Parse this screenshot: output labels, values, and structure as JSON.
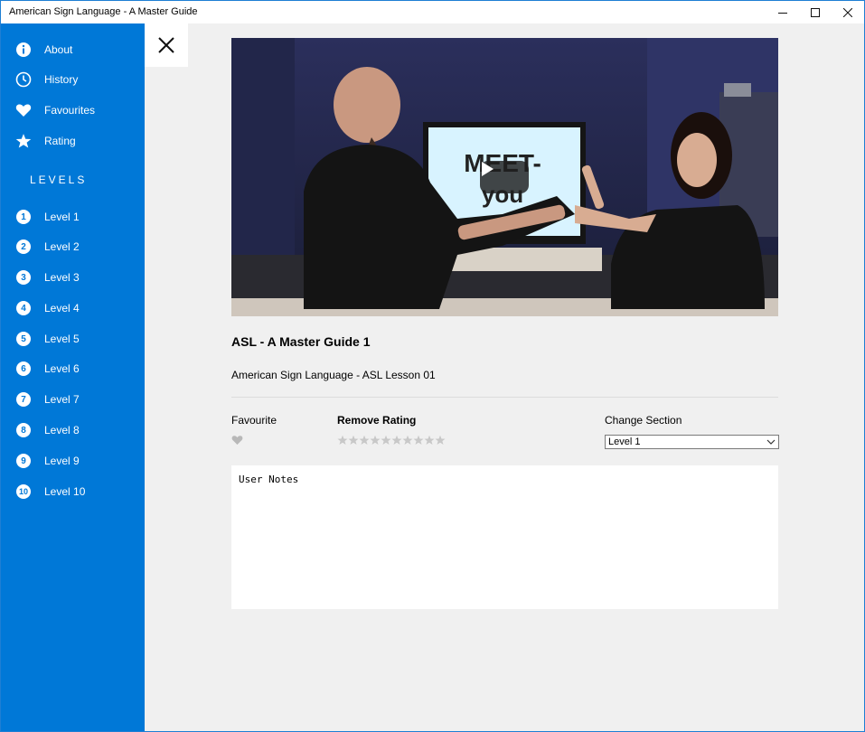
{
  "window": {
    "title": "American Sign Language - A Master Guide"
  },
  "sidebar": {
    "items": [
      {
        "label": "About",
        "icon": "info-icon"
      },
      {
        "label": "History",
        "icon": "clock-icon"
      },
      {
        "label": "Favourites",
        "icon": "heart-icon"
      },
      {
        "label": "Rating",
        "icon": "star-icon"
      }
    ],
    "levels_header": "LEVELS",
    "levels": [
      {
        "num": "1",
        "label": "Level 1"
      },
      {
        "num": "2",
        "label": "Level 2"
      },
      {
        "num": "3",
        "label": "Level 3"
      },
      {
        "num": "4",
        "label": "Level 4"
      },
      {
        "num": "5",
        "label": "Level 5"
      },
      {
        "num": "6",
        "label": "Level 6"
      },
      {
        "num": "7",
        "label": "Level 7"
      },
      {
        "num": "8",
        "label": "Level 8"
      },
      {
        "num": "9",
        "label": "Level 9"
      },
      {
        "num": "10",
        "label": "Level 10"
      }
    ]
  },
  "video": {
    "sign_text_line1": "MEET-",
    "sign_text_line2": "you",
    "title": "ASL - A Master Guide 1",
    "subtitle": "American Sign Language - ASL Lesson 01"
  },
  "controls": {
    "favourite_label": "Favourite",
    "rating_label": "Remove Rating",
    "rating_value": 0,
    "rating_max": 10,
    "section_label": "Change Section",
    "section_selected": "Level 1"
  },
  "notes": {
    "value": "User Notes"
  },
  "colors": {
    "accent": "#0078d7",
    "background": "#f0f0f0",
    "star_inactive": "#c8c8c8",
    "heart_inactive": "#b8b8b8"
  }
}
